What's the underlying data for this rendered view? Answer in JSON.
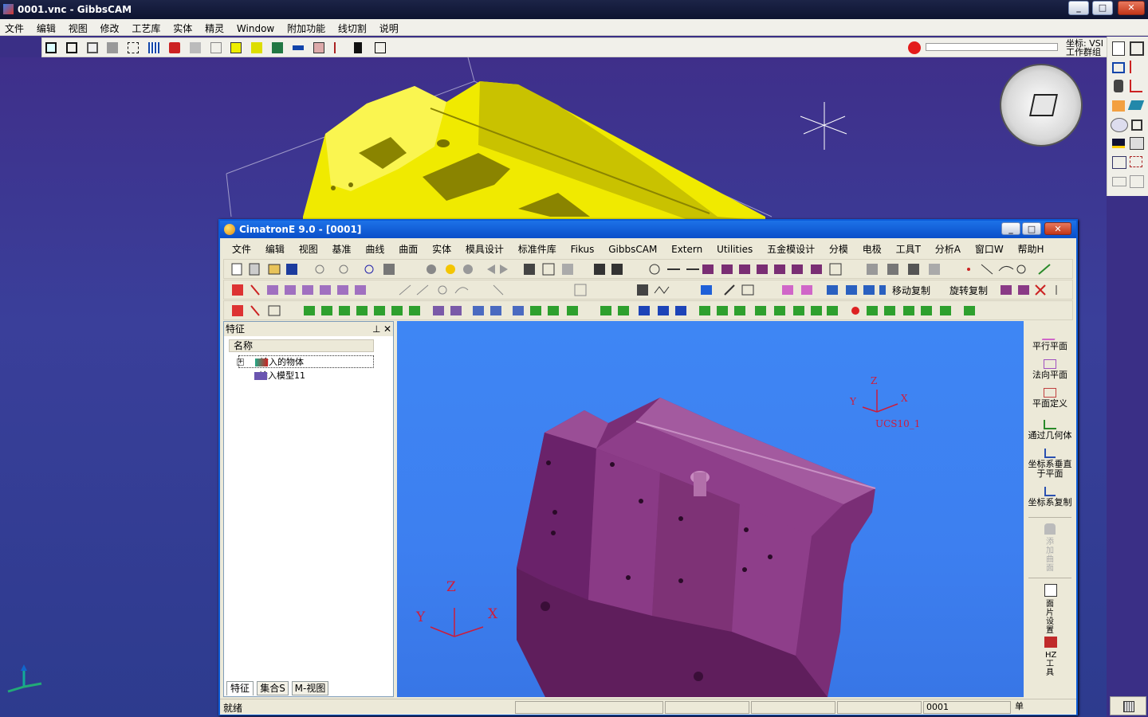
{
  "gibbs": {
    "title": "0001.vnc - GibbsCAM",
    "menu": [
      "文件",
      "编辑",
      "视图",
      "修改",
      "工艺库",
      "实体",
      "精灵",
      "Window",
      "附加功能",
      "线切割",
      "说明"
    ],
    "coord_label": "坐标: VSI",
    "workgroup_label": "工作群组"
  },
  "cimatron": {
    "title": "CimatronE 9.0 - [0001]",
    "menu": [
      "文件",
      "编辑",
      "视图",
      "基准",
      "曲线",
      "曲面",
      "实体",
      "模具设计",
      "标准件库",
      "Fikus",
      "GibbsCAM",
      "Extern",
      "Utilities",
      "五金模设计",
      "分模",
      "电极",
      "工具T",
      "分析A",
      "窗口W",
      "帮助H"
    ],
    "toolbar_text": {
      "move_copy": "移动复制",
      "rotate_copy": "旋转复制"
    },
    "feature_panel": {
      "title": "特征",
      "column_name": "名称",
      "items": [
        "输入的物体",
        "输入模型11"
      ]
    },
    "tabs": [
      "特征",
      "集合S",
      "M-视图"
    ],
    "right_panel": [
      "平行平面",
      "法向平面",
      "平面定义",
      "通过几何体",
      "坐标系垂直于平面",
      "坐标系复制"
    ],
    "right_panel_vertical": [
      "添加曲面",
      "面片设置",
      "HZ工具"
    ],
    "viewport": {
      "ucs_label": "UCS10_1",
      "axis_x": "X",
      "axis_y": "Y",
      "axis_z": "Z"
    },
    "status": {
      "text": "就绪",
      "file": "0001",
      "unit": "单"
    }
  },
  "colors": {
    "gibbs_part": "#f0ea00",
    "cimatron_part": "#8a3a86",
    "cimatron_bg": "#3e86f4",
    "gibbs_bg": "#3a2f86"
  }
}
